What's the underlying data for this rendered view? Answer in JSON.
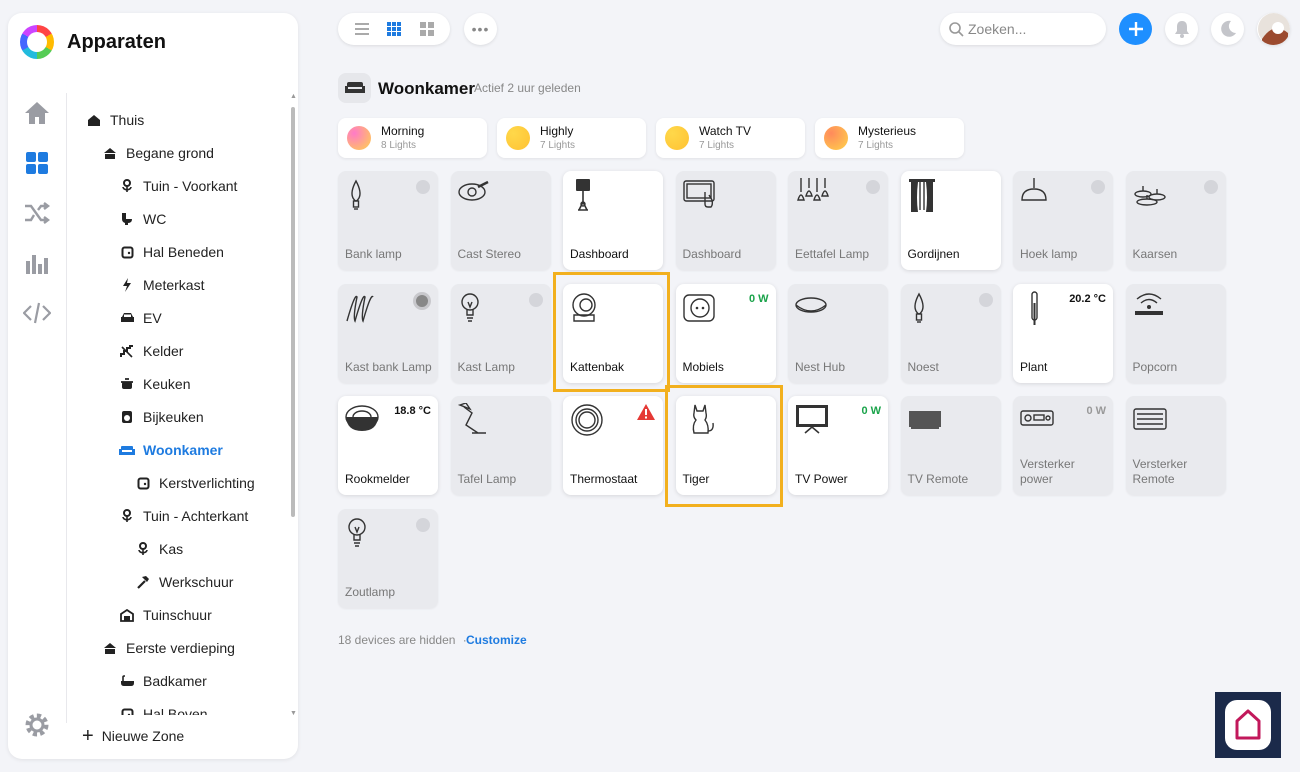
{
  "app": {
    "title": "Apparaten"
  },
  "sidebar": {
    "tree": [
      {
        "label": "Thuis",
        "icon": "house-icon",
        "level": 0
      },
      {
        "label": "Begane grond",
        "icon": "floor-icon",
        "level": 1
      },
      {
        "label": "Tuin - Voorkant",
        "icon": "flower-icon",
        "level": 2
      },
      {
        "label": "WC",
        "icon": "toilet-icon",
        "level": 2
      },
      {
        "label": "Hal Beneden",
        "icon": "door-icon",
        "level": 2
      },
      {
        "label": "Meterkast",
        "icon": "bolt-icon",
        "level": 2
      },
      {
        "label": "EV",
        "icon": "car-icon",
        "level": 2
      },
      {
        "label": "Kelder",
        "icon": "stairs-icon",
        "level": 2
      },
      {
        "label": "Keuken",
        "icon": "pot-icon",
        "level": 2
      },
      {
        "label": "Bijkeuken",
        "icon": "washer-icon",
        "level": 2
      },
      {
        "label": "Woonkamer",
        "icon": "sofa-icon",
        "level": 2,
        "active": true
      },
      {
        "label": "Kerstverlichting",
        "icon": "door-icon",
        "level": 3
      },
      {
        "label": "Tuin - Achterkant",
        "icon": "flower-icon",
        "level": 2
      },
      {
        "label": "Kas",
        "icon": "flower-icon",
        "level": 3
      },
      {
        "label": "Werkschuur",
        "icon": "hammer-icon",
        "level": 3
      },
      {
        "label": "Tuinschuur",
        "icon": "shed-icon",
        "level": 2
      },
      {
        "label": "Eerste verdieping",
        "icon": "floor-icon",
        "level": 1
      },
      {
        "label": "Badkamer",
        "icon": "bath-icon",
        "level": 2
      },
      {
        "label": "Hal Boven",
        "icon": "door-icon",
        "level": 2
      }
    ],
    "add_zone": "Nieuwe Zone"
  },
  "search": {
    "placeholder": "Zoeken..."
  },
  "zone": {
    "title": "Woonkamer",
    "subtitle": "Actief 2 uur geleden"
  },
  "scenes": [
    {
      "name": "Morning",
      "count": "8 Lights",
      "gradient": [
        "#ff7ac8",
        "#ffd34a"
      ]
    },
    {
      "name": "Highly",
      "count": "7 Lights",
      "gradient": [
        "#ffd84a",
        "#ffc233"
      ]
    },
    {
      "name": "Watch TV",
      "count": "7 Lights",
      "gradient": [
        "#ffd84a",
        "#ffc233"
      ]
    },
    {
      "name": "Mysterieus",
      "count": "7 Lights",
      "gradient": [
        "#ff8a5c",
        "#ffd34a"
      ]
    }
  ],
  "devices": [
    {
      "name": "Bank lamp",
      "icon": "bulb-candle-icon",
      "on": false,
      "toggle": "light"
    },
    {
      "name": "Cast Stereo",
      "icon": "speaker-icon",
      "on": false
    },
    {
      "name": "Dashboard",
      "icon": "tablet-stand-icon",
      "on": true
    },
    {
      "name": "Dashboard",
      "icon": "tablet-icon",
      "on": false
    },
    {
      "name": "Eettafel Lamp",
      "icon": "pendant-icon",
      "on": false,
      "toggle": "light"
    },
    {
      "name": "Gordijnen",
      "icon": "curtains-icon",
      "on": true
    },
    {
      "name": "Hoek lamp",
      "icon": "ceiling-lamp-icon",
      "on": false,
      "toggle": "light"
    },
    {
      "name": "Kaarsen",
      "icon": "candles-icon",
      "on": false,
      "toggle": "light"
    },
    {
      "name": "Kast bank Lamp",
      "icon": "led-strip-icon",
      "on": false,
      "toggle": "dark"
    },
    {
      "name": "Kast Lamp",
      "icon": "bulb-icon",
      "on": false,
      "toggle": "light"
    },
    {
      "name": "Kattenbak",
      "icon": "litterbox-icon",
      "on": true
    },
    {
      "name": "Mobiels",
      "icon": "socket-icon",
      "on": true,
      "value": "0 W",
      "value_style": "green"
    },
    {
      "name": "Nest Hub",
      "icon": "hub-icon",
      "on": false
    },
    {
      "name": "Noest",
      "icon": "bulb-candle-icon",
      "on": false,
      "toggle": "light"
    },
    {
      "name": "Plant",
      "icon": "thermometer-icon",
      "on": true,
      "value": "20.2 °C",
      "value_style": "black"
    },
    {
      "name": "Popcorn",
      "icon": "router-icon",
      "on": false
    },
    {
      "name": "Rookmelder",
      "icon": "smoke-detector-icon",
      "on": true,
      "value": "18.8 °C",
      "value_style": "black"
    },
    {
      "name": "Tafel Lamp",
      "icon": "desk-lamp-icon",
      "on": false
    },
    {
      "name": "Thermostaat",
      "icon": "thermostat-icon",
      "on": true,
      "warning": true
    },
    {
      "name": "Tiger",
      "icon": "cat-icon",
      "on": true
    },
    {
      "name": "TV Power",
      "icon": "tv-icon",
      "on": true,
      "value": "0 W",
      "value_style": "green"
    },
    {
      "name": "TV Remote",
      "icon": "tv-flat-icon",
      "on": false
    },
    {
      "name": "Versterker power",
      "icon": "amplifier-icon",
      "on": false,
      "value": "0 W",
      "value_style": "grey"
    },
    {
      "name": "Versterker Remote",
      "icon": "receiver-icon",
      "on": false
    },
    {
      "name": "Zoutlamp",
      "icon": "bulb-icon",
      "on": false,
      "toggle": "light"
    }
  ],
  "footer": {
    "hidden": "18 devices are hidden",
    "separator": "·",
    "customize": "Customize"
  },
  "colors": {
    "accent": "#1e7be0",
    "highlight": "#f2b01e",
    "power": "#1aa34a",
    "warning": "#e53935"
  }
}
